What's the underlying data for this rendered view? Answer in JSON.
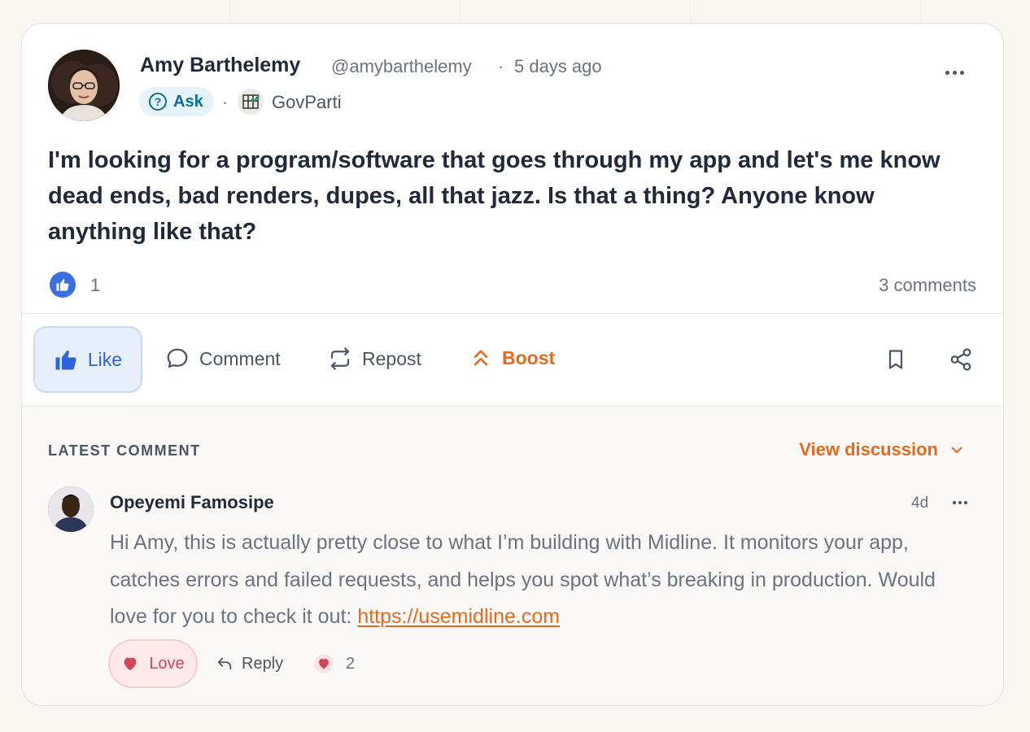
{
  "post": {
    "author_name": "Amy Barthelemy",
    "author_handle": "@amybarthelemy",
    "separator": "·",
    "time": "5 days ago",
    "tag_label": "Ask",
    "group_name": "GovParti",
    "body": "I'm looking for a program/software that goes through my app and let's me know dead ends, bad renders, dupes, all that jazz. Is that a thing? Anyone know anything like that?",
    "like_count": "1",
    "comment_count": "3 comments"
  },
  "actions": {
    "like_label": "Like",
    "comment_label": "Comment",
    "repost_label": "Repost",
    "boost_label": "Boost"
  },
  "latest_comment": {
    "section_label": "LATEST COMMENT",
    "view_discussion_label": "View discussion",
    "author_name": "Opeyemi Famosipe",
    "time": "4d",
    "body_text": "Hi Amy, this is actually pretty close to what I’m building with Midline. It monitors your app, catches errors and failed requests, and helps you spot what’s breaking in production. Would love for you to check it out: ",
    "link_text": "https://usemidline.com",
    "love_label": "Love",
    "reply_label": "Reply",
    "love_count": "2"
  },
  "colors": {
    "accent_orange": "#e36a1f",
    "like_blue": "#2f63d8",
    "love_red": "#d24657"
  },
  "icons": [
    "question-icon",
    "govparti-logo-icon",
    "thumbs-up-icon",
    "comment-bubble-icon",
    "repost-icon",
    "boost-chevrons-icon",
    "bookmark-icon",
    "share-icon",
    "chevron-down-icon",
    "heart-icon",
    "reply-arrow-icon",
    "more-dots-icon"
  ]
}
